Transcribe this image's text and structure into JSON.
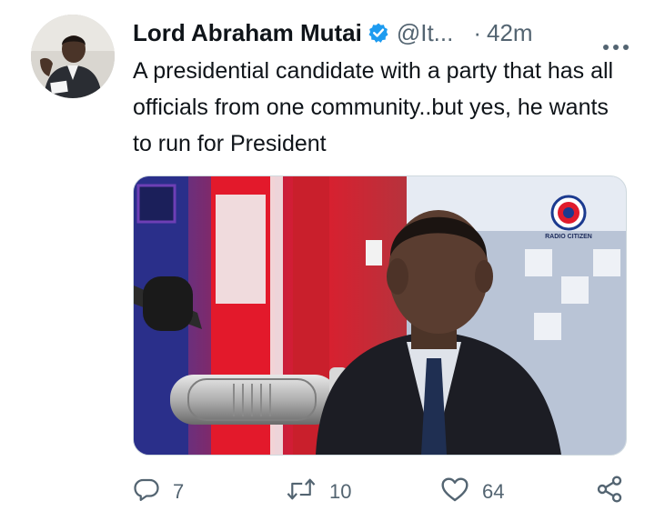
{
  "tweet": {
    "author_name": "Lord Abraham Mutai",
    "handle": "@It...",
    "separator": "·",
    "time": "42m",
    "text": "A presidential candidate with a party that has all officials from one community..but yes, he wants to run for President"
  },
  "media": {
    "watermark": "RADIO CITIZEN"
  },
  "actions": {
    "reply_count": "7",
    "retweet_count": "10",
    "like_count": "64"
  },
  "colors": {
    "verified": "#1d9bf0",
    "text": "#0f1419",
    "muted": "#536471"
  },
  "icons": {
    "verified": "verified-badge-icon",
    "more": "more-dots-icon",
    "reply": "reply-icon",
    "retweet": "retweet-icon",
    "like": "heart-icon",
    "share": "share-icon"
  }
}
